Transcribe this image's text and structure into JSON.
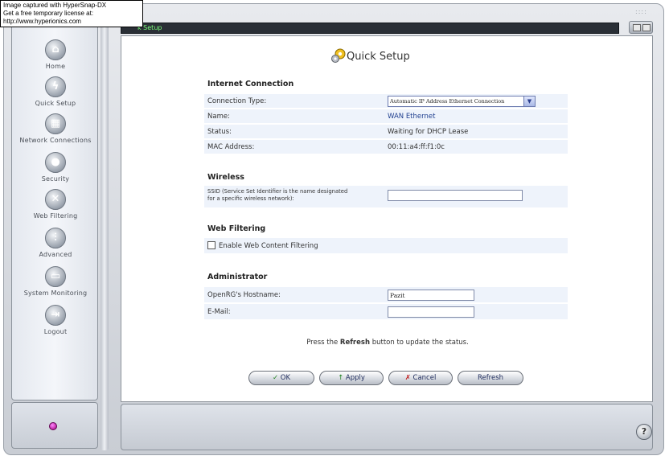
{
  "capture_note": {
    "line1": "Image captured with HyperSnap-DX",
    "line2": "Get a free temporary license at:",
    "line3": "http://www.hyperionics.com"
  },
  "window": {
    "titlebar_text": "k Setup",
    "corner_deco": "::::"
  },
  "sidebar": {
    "items": [
      {
        "label": "Home",
        "icon": "home-icon",
        "glyph": "⌂"
      },
      {
        "label": "Quick Setup",
        "icon": "lightning-icon",
        "glyph": "ϟ"
      },
      {
        "label": "Network Connections",
        "icon": "network-icon",
        "glyph": "▦"
      },
      {
        "label": "Security",
        "icon": "lock-icon",
        "glyph": "●"
      },
      {
        "label": "Web Filtering",
        "icon": "filter-icon",
        "glyph": "✕"
      },
      {
        "label": "Advanced",
        "icon": "advanced-icon",
        "glyph": "⫶"
      },
      {
        "label": "System Monitoring",
        "icon": "monitor-icon",
        "glyph": "▭"
      },
      {
        "label": "Logout",
        "icon": "logout-icon",
        "glyph": "⇥"
      }
    ]
  },
  "page": {
    "title": "Quick Setup",
    "sections": {
      "internet": {
        "title": "Internet Connection",
        "connection_type_label": "Connection Type:",
        "connection_type_value": "Automatic IP Address Ethernet Connection",
        "name_label": "Name:",
        "name_value": "WAN Ethernet",
        "status_label": "Status:",
        "status_value": "Waiting for DHCP Lease",
        "mac_label": "MAC Address:",
        "mac_value": "00:11:a4:ff:f1:0c"
      },
      "wireless": {
        "title": "Wireless",
        "ssid_label_line1": "SSID (Service Set Identifier is the name designated",
        "ssid_label_line2": "for a specific wireless network):",
        "ssid_value": ""
      },
      "web_filtering": {
        "title": "Web Filtering",
        "enable_label": "Enable Web Content Filtering",
        "enabled": false
      },
      "administrator": {
        "title": "Administrator",
        "hostname_label": "OpenRG's Hostname:",
        "hostname_value": "Pazit",
        "email_label": "E-Mail:",
        "email_value": ""
      }
    },
    "hint": {
      "before": "Press the",
      "bold": "Refresh",
      "after": "button to update the status."
    },
    "buttons": {
      "ok": "OK",
      "apply": "Apply",
      "cancel": "Cancel",
      "refresh": "Refresh",
      "ok_glyph": "✓",
      "apply_glyph": "↑",
      "cancel_glyph": "✗"
    }
  },
  "help_glyph": "?",
  "colors": {
    "row_bg": "#eef3fb",
    "titlebar_bg": "#2a2f36",
    "titlebar_text": "#7cff7c",
    "link": "#1f3f8f"
  }
}
